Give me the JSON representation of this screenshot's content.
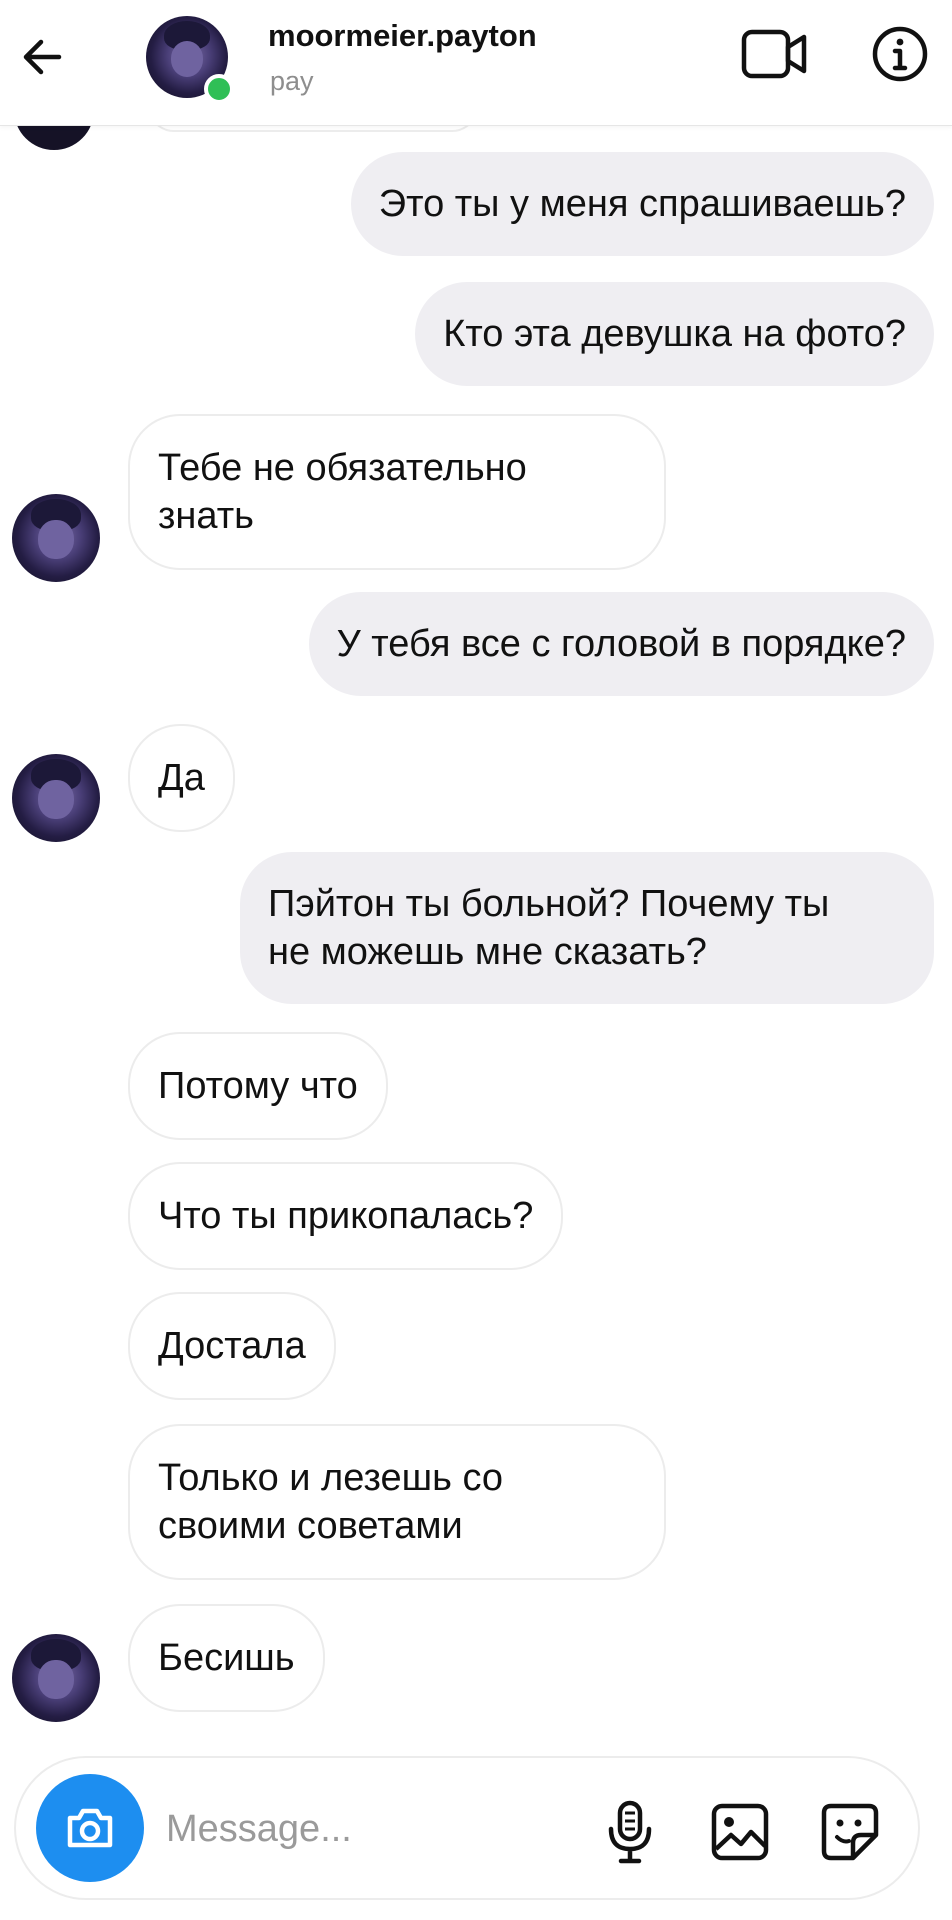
{
  "header": {
    "username": "moormeier.payton",
    "subtitle": "pay"
  },
  "messages": [
    {
      "side": "out",
      "text": "Это ты у меня спрашиваешь?"
    },
    {
      "side": "out",
      "text": "Кто эта девушка на фото?"
    },
    {
      "side": "in",
      "line1": "Тебе не обязательно",
      "line2": "знать"
    },
    {
      "side": "out",
      "text": "У тебя все с головой в порядке?"
    },
    {
      "side": "in",
      "text": "Да"
    },
    {
      "side": "out",
      "line1": "Пэйтон ты больной? Почему ты",
      "line2": "не можешь мне сказать?"
    },
    {
      "side": "in",
      "text": "Потому что"
    },
    {
      "side": "in",
      "text": "Что ты прикопалась?"
    },
    {
      "side": "in",
      "text": "Достала"
    },
    {
      "side": "in",
      "line1": "Только и лезешь со",
      "line2": "своими советами"
    },
    {
      "side": "in",
      "text": "Бесишь"
    }
  ],
  "composer": {
    "placeholder": "Message..."
  },
  "colors": {
    "accent": "#1d8ef0",
    "online": "#2fbf56",
    "outgoing_bubble": "#efeef2",
    "incoming_border": "#ececec",
    "muted_text": "#8e8e8e"
  },
  "icons": [
    "back-arrow-icon",
    "video-camera-icon",
    "info-icon",
    "camera-icon",
    "microphone-icon",
    "gallery-icon",
    "sticker-icon"
  ]
}
